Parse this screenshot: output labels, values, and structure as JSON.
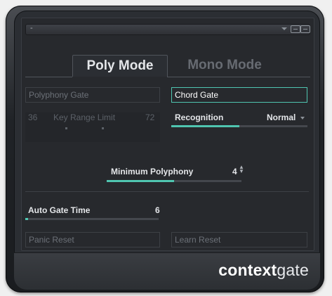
{
  "preset": {
    "name": "-"
  },
  "tabs": [
    {
      "label": "Poly Mode",
      "active": true
    },
    {
      "label": "Mono Mode",
      "active": false
    }
  ],
  "poly_gate": {
    "label": "Polyphony Gate",
    "active": false
  },
  "chord_gate": {
    "label": "Chord Gate",
    "active": true
  },
  "key_range": {
    "low": "36",
    "label": "Key Range Limit",
    "high": "72"
  },
  "recognition": {
    "label": "Recognition",
    "value": "Normal",
    "level": 0.5
  },
  "min_polyphony": {
    "label": "Minimum Polyphony",
    "value": "4",
    "level": 0.5
  },
  "auto_gate_time": {
    "label": "Auto Gate Time",
    "value": "6",
    "level": 0.02
  },
  "buttons": {
    "panic_reset": "Panic Reset",
    "learn_reset": "Learn Reset"
  },
  "logo": {
    "bold": "context",
    "normal": "gate"
  },
  "colors": {
    "accent": "#4fc5b0",
    "background": "#27292d"
  }
}
